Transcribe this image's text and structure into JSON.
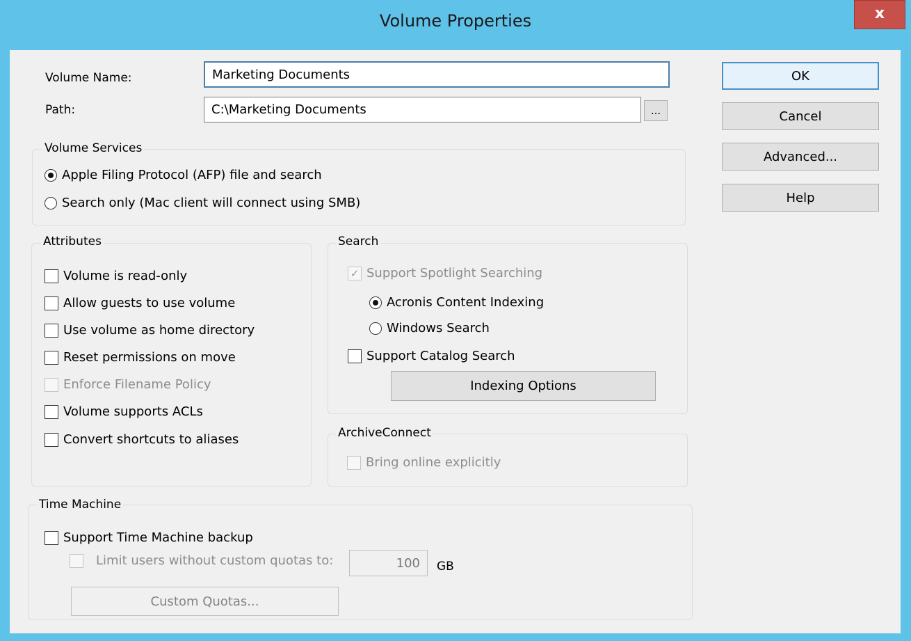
{
  "window": {
    "title": "Volume Properties",
    "close_glyph": "x"
  },
  "form": {
    "volume_name_label": "Volume Name:",
    "volume_name_value": "Marketing Documents",
    "path_label": "Path:",
    "path_value": "C:\\Marketing Documents",
    "browse_label": "..."
  },
  "buttons": {
    "ok": "OK",
    "cancel": "Cancel",
    "advanced": "Advanced...",
    "help": "Help"
  },
  "volume_services": {
    "title": "Volume Services",
    "options": [
      {
        "label": "Apple Filing Protocol (AFP) file and search",
        "selected": true
      },
      {
        "label": "Search only (Mac client will connect using SMB)",
        "selected": false
      }
    ]
  },
  "attributes": {
    "title": "Attributes",
    "items": [
      {
        "label": "Volume is read-only",
        "checked": false,
        "enabled": true
      },
      {
        "label": "Allow guests to use volume",
        "checked": false,
        "enabled": true
      },
      {
        "label": "Use volume as home directory",
        "checked": false,
        "enabled": true
      },
      {
        "label": "Reset permissions on move",
        "checked": false,
        "enabled": true
      },
      {
        "label": "Enforce Filename Policy",
        "checked": false,
        "enabled": false
      },
      {
        "label": "Volume supports ACLs",
        "checked": false,
        "enabled": true
      },
      {
        "label": "Convert shortcuts to aliases",
        "checked": false,
        "enabled": true
      }
    ]
  },
  "search": {
    "title": "Search",
    "spotlight_label": "Support Spotlight Searching",
    "spotlight_checked": true,
    "acronis_label": "Acronis Content Indexing",
    "windows_search_label": "Windows Search",
    "catalog_label": "Support Catalog Search",
    "indexing_button": "Indexing Options"
  },
  "archive_connect": {
    "title": "ArchiveConnect",
    "bring_online_label": "Bring online explicitly"
  },
  "time_machine": {
    "title": "Time Machine",
    "support_label": "Support Time Machine backup",
    "limit_label": "Limit users without custom quotas to:",
    "quota_value": "100",
    "unit": "GB",
    "custom_quotas_button": "Custom Quotas..."
  }
}
